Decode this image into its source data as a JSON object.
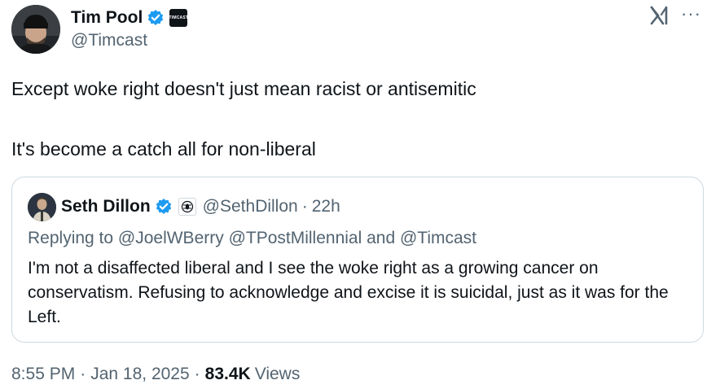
{
  "author": {
    "display_name": "Tim Pool",
    "handle": "@Timcast",
    "affiliate_badge_text": "TIMCAST"
  },
  "header": {
    "x_logo": "x-logo-icon",
    "more": "···"
  },
  "tweet": {
    "paragraphs": [
      "Except woke right doesn't just mean racist or antisemitic",
      "It's become a catch all for non-liberal"
    ]
  },
  "quote": {
    "display_name": "Seth Dillon",
    "handle": "@SethDillon",
    "separator": "·",
    "time": "22h",
    "replying_to": "Replying to @JoelWBerry @TPostMillennial and @Timcast",
    "text": "I'm not a disaffected liberal and I see the woke right as a growing cancer on conservatism. Refusing to acknowledge and excise it is suicidal, just as it was for the Left."
  },
  "meta": {
    "time": "8:55 PM",
    "separator": "·",
    "date": "Jan 18, 2025",
    "separator2": "·",
    "views_count": "83.4K",
    "views_label": "Views"
  },
  "colors": {
    "text": "#0f1419",
    "secondary": "#536471",
    "verified": "#1d9bf0",
    "border": "#cfd9de"
  }
}
